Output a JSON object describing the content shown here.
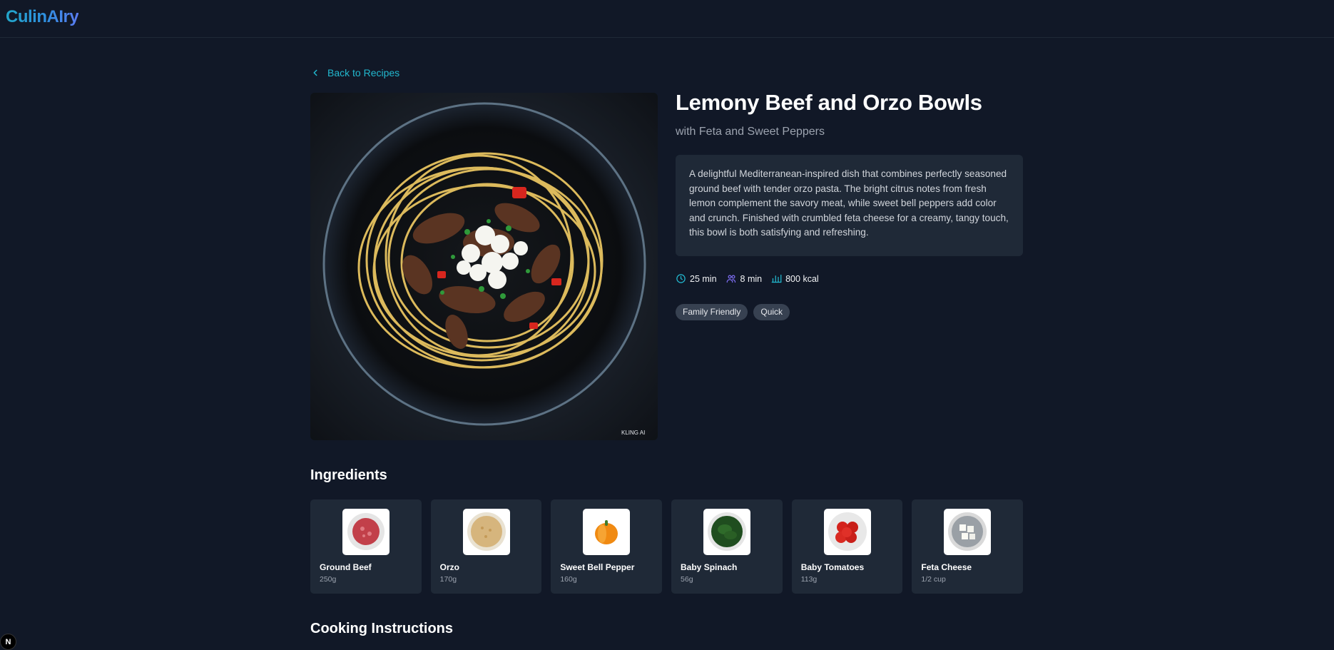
{
  "app": {
    "logo": "CulinAIry"
  },
  "nav": {
    "back_label": "Back to Recipes"
  },
  "recipe": {
    "title": "Lemony Beef and Orzo Bowls",
    "subtitle": "with Feta and Sweet Peppers",
    "description": "A delightful Mediterranean-inspired dish that combines perfectly seasoned ground beef with tender orzo pasta. The bright citrus notes from fresh lemon complement the savory meat, while sweet bell peppers add color and crunch. Finished with crumbled feta cheese for a creamy, tangy touch, this bowl is both satisfying and refreshing.",
    "image_watermark": "KLING AI",
    "meta": {
      "total_time": "25 min",
      "prep_time": "8 min",
      "calories": "800 kcal"
    },
    "tags": [
      "Family Friendly",
      "Quick"
    ]
  },
  "sections": {
    "ingredients_title": "Ingredients",
    "instructions_title": "Cooking Instructions"
  },
  "ingredients": [
    {
      "name": "Ground Beef",
      "qty": "250g",
      "icon": "ground-beef-image"
    },
    {
      "name": "Orzo",
      "qty": "170g",
      "icon": "orzo-image"
    },
    {
      "name": "Sweet Bell Pepper",
      "qty": "160g",
      "icon": "bell-pepper-image"
    },
    {
      "name": "Baby Spinach",
      "qty": "56g",
      "icon": "spinach-image"
    },
    {
      "name": "Baby Tomatoes",
      "qty": "113g",
      "icon": "tomatoes-image"
    },
    {
      "name": "Feta Cheese",
      "qty": "1/2 cup",
      "icon": "feta-image"
    }
  ],
  "corner_badge": "N",
  "colors": {
    "background": "#111827",
    "card": "#1f2937",
    "accent": "#22b8cf",
    "tag": "#374151"
  }
}
